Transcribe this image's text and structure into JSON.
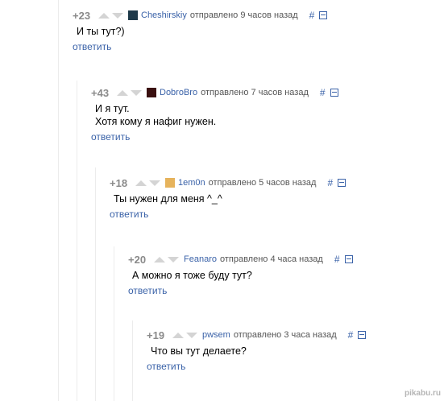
{
  "comments": [
    {
      "rating": "+23",
      "username": "Cheshirskiy",
      "posted": "отправлено 9 часов назад",
      "hash": "#",
      "lines": [
        "И ты тут?)"
      ],
      "reply_label": "ответить",
      "avatar_color": "#1f3a4a"
    },
    {
      "rating": "+43",
      "username": "DobroBro",
      "posted": "отправлено 7 часов назад",
      "hash": "#",
      "lines": [
        "И я тут.",
        "Хотя кому я нафиг нужен."
      ],
      "reply_label": "ответить",
      "avatar_color": "#3a1010"
    },
    {
      "rating": "+18",
      "username": "1em0n",
      "posted": "отправлено 5 часов назад",
      "hash": "#",
      "lines": [
        "Ты нужен для меня ^_^"
      ],
      "reply_label": "ответить",
      "avatar_color": "#e6b35c"
    },
    {
      "rating": "+20",
      "username": "Feanaro",
      "posted": "отправлено 4 часа назад",
      "hash": "#",
      "lines": [
        "А можно я тоже буду тут?"
      ],
      "reply_label": "ответить",
      "avatar_color": ""
    },
    {
      "rating": "+19",
      "username": "pwsem",
      "posted": "отправлено 3 часа назад",
      "hash": "#",
      "lines": [
        "Что вы тут делаете?"
      ],
      "reply_label": "ответить",
      "avatar_color": ""
    }
  ],
  "watermark": "pikabu.ru",
  "colors": {
    "link": "#3a62a8",
    "rating": "#8a8a8a",
    "arrow": "#d4d4d4"
  }
}
